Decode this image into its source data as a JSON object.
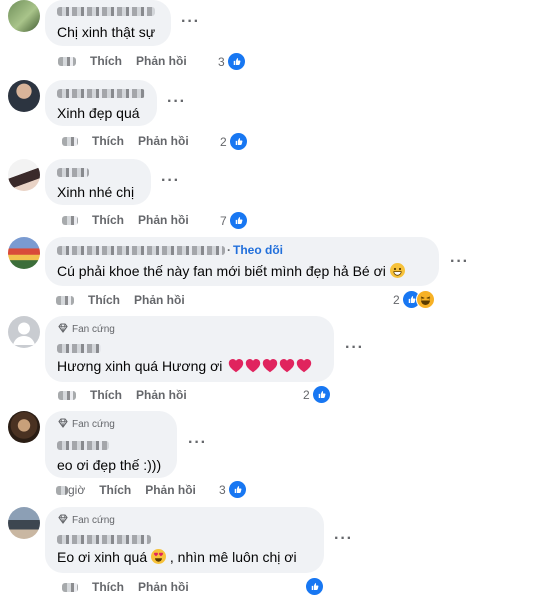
{
  "actions": {
    "like": "Thích",
    "reply": "Phản hồi"
  },
  "comments": [
    {
      "text": "Chị xinh thật sự",
      "reactions": "3"
    },
    {
      "text": "Xinh đẹp quá",
      "reactions": "2"
    },
    {
      "text": "Xinh nhé chị",
      "reactions": "7"
    },
    {
      "follow": "Theo dõi",
      "text": "Cú phải khoe thế này fan mới biết mình đẹp hả Bé ơi",
      "reactions": "2"
    },
    {
      "badge": "Fan cứng",
      "text": "Hương xinh quá Hương ơi",
      "reactions": "2"
    },
    {
      "badge": "Fan cứng",
      "text": "eo ơi đẹp thế :)))",
      "time": "giờ",
      "reactions": "3"
    },
    {
      "badge": "Fan cứng",
      "text_before": "Eo ơi xinh quá",
      "text_after": ", nhìn mê luôn chị ơi",
      "reactions": ""
    }
  ],
  "icons": {
    "like": "like-icon",
    "haha": "haha-icon",
    "fan_badge": "diamond-icon",
    "more": "more-options-icon"
  },
  "colors": {
    "bubble": "#f0f2f5",
    "meta": "#65676b",
    "like_blue": "#1877f2",
    "follow_blue": "#216fdb"
  }
}
